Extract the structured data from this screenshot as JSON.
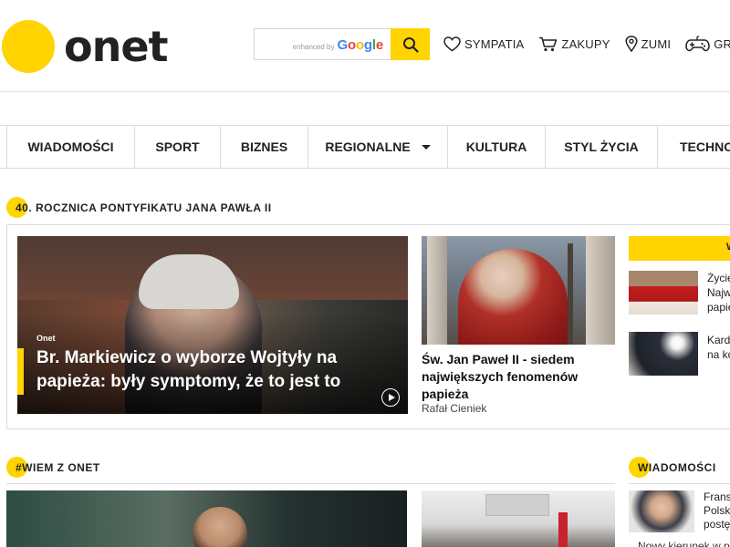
{
  "header": {
    "logo_text": "onet",
    "search": {
      "enhanced_label": "enhanced by",
      "google_label": "Google"
    },
    "links": [
      {
        "label": "SYMPATIA",
        "icon": "heart-icon"
      },
      {
        "label": "ZAKUPY",
        "icon": "cart-icon"
      },
      {
        "label": "ZUMI",
        "icon": "map-pin-icon"
      },
      {
        "label": "GRY",
        "icon": "gamepad-icon"
      }
    ]
  },
  "nav": {
    "items": [
      {
        "label": "WIADOMOŚCI"
      },
      {
        "label": "SPORT"
      },
      {
        "label": "BIZNES"
      },
      {
        "label": "REGIONALNE"
      },
      {
        "label": "KULTURA"
      },
      {
        "label": "STYL ŻYCIA"
      },
      {
        "label": "TECHNOLOG"
      }
    ]
  },
  "section1": {
    "title": "40. ROCZNICA PONTYFIKATU JANA PAWŁA II",
    "hero": {
      "source": "Onet",
      "title": "Br. Markiewicz o wyborze Wojtyły na papieża: były symptomy, że to jest to"
    },
    "card": {
      "title": "Św. Jan Paweł II - siedem największych fenomenów papieża",
      "author": "Rafał Cieniek"
    },
    "side": {
      "header_label": "W",
      "items": [
        {
          "lines": [
            "Życie",
            "Najw",
            "papie"
          ]
        },
        {
          "lines": [
            "Kard",
            "na ko"
          ]
        }
      ]
    }
  },
  "section2": {
    "title": "#WIEM Z ONET"
  },
  "section3": {
    "title": "WIADOMOŚCI",
    "item_lines": [
      "Frans",
      "Polsk",
      "postę"
    ],
    "caption": "Nowy kierunek w pi"
  },
  "colors": {
    "accent": "#ffd400",
    "text": "#222222",
    "border": "#dcdcdc"
  }
}
